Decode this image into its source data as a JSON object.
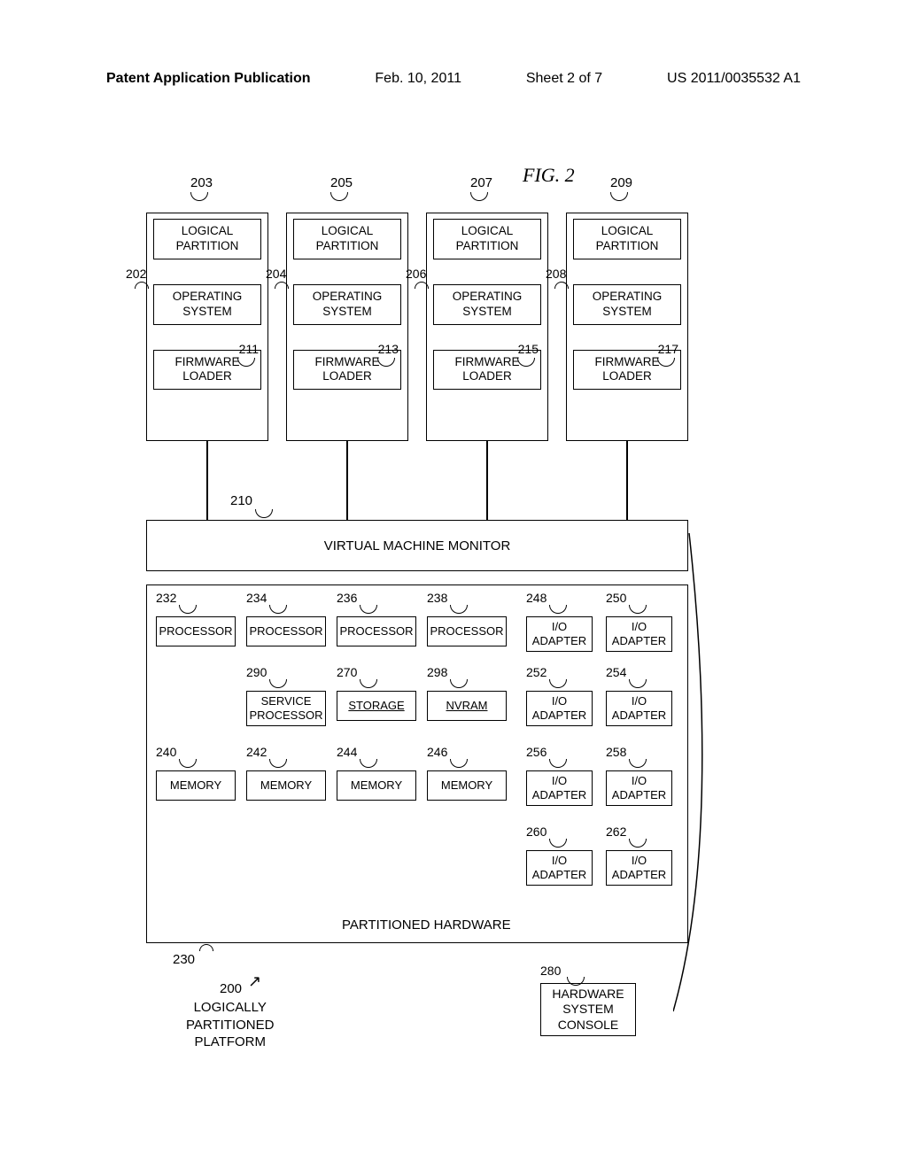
{
  "header": {
    "left": "Patent Application Publication",
    "date": "Feb. 10, 2011",
    "sheet": "Sheet 2 of 7",
    "pubno": "US 2011/0035532 A1"
  },
  "figure_title": "FIG. 2",
  "partitions": [
    {
      "ref_top": "203",
      "ref_os": "202",
      "ref_fw": "211",
      "lp": "LOGICAL PARTITION",
      "os": "OPERATING SYSTEM",
      "fw": "FIRMWARE LOADER"
    },
    {
      "ref_top": "205",
      "ref_os": "204",
      "ref_fw": "213",
      "lp": "LOGICAL PARTITION",
      "os": "OPERATING SYSTEM",
      "fw": "FIRMWARE LOADER"
    },
    {
      "ref_top": "207",
      "ref_os": "206",
      "ref_fw": "215",
      "lp": "LOGICAL PARTITION",
      "os": "OPERATING SYSTEM",
      "fw": "FIRMWARE LOADER"
    },
    {
      "ref_top": "209",
      "ref_os": "208",
      "ref_fw": "217",
      "lp": "LOGICAL PARTITION",
      "os": "OPERATING SYSTEM",
      "fw": "FIRMWARE LOADER"
    }
  ],
  "vmm": {
    "ref": "210",
    "label": "VIRTUAL MACHINE MONITOR"
  },
  "phw": {
    "label": "PARTITIONED HARDWARE",
    "ref": "230",
    "lpp_ref": "200",
    "lpp_label": "LOGICALLY\nPARTITIONED\nPLATFORM",
    "console_ref": "280",
    "console_label": "HARDWARE SYSTEM CONSOLE",
    "row1": [
      {
        "ref": "232",
        "label": "PROCESSOR"
      },
      {
        "ref": "234",
        "label": "PROCESSOR"
      },
      {
        "ref": "236",
        "label": "PROCESSOR"
      },
      {
        "ref": "238",
        "label": "PROCESSOR"
      },
      {
        "ref": "248",
        "label": "I/O ADAPTER"
      },
      {
        "ref": "250",
        "label": "I/O ADAPTER"
      }
    ],
    "row2": [
      {
        "ref": "290",
        "label": "SERVICE PROCESSOR"
      },
      {
        "ref": "270",
        "label": "STORAGE"
      },
      {
        "ref": "298",
        "label": "NVRAM"
      },
      {
        "ref": "252",
        "label": "I/O ADAPTER"
      },
      {
        "ref": "254",
        "label": "I/O ADAPTER"
      }
    ],
    "row3": [
      {
        "ref": "240",
        "label": "MEMORY"
      },
      {
        "ref": "242",
        "label": "MEMORY"
      },
      {
        "ref": "244",
        "label": "MEMORY"
      },
      {
        "ref": "246",
        "label": "MEMORY"
      },
      {
        "ref": "256",
        "label": "I/O ADAPTER"
      },
      {
        "ref": "258",
        "label": "I/O ADAPTER"
      }
    ],
    "row4": [
      {
        "ref": "260",
        "label": "I/O ADAPTER"
      },
      {
        "ref": "262",
        "label": "I/O ADAPTER"
      }
    ]
  }
}
